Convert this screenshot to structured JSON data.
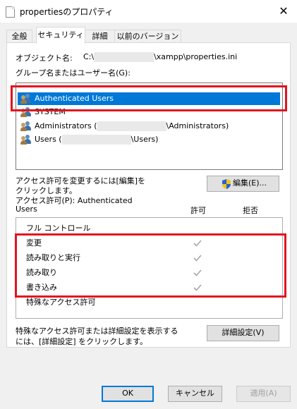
{
  "window": {
    "title": "propertiesのプロパティ",
    "close_glyph": "✕"
  },
  "tabs": [
    {
      "label": "全般",
      "active": false
    },
    {
      "label": "セキュリティ",
      "active": true
    },
    {
      "label": "詳細",
      "active": false
    },
    {
      "label": "以前のバージョン",
      "active": false
    }
  ],
  "security": {
    "object_name_label": "オブジェクト名:",
    "object_path_prefix": "C:\\",
    "object_path_suffix": "\\xampp\\properties.ini",
    "group_label": "グループ名またはユーザー名(G):",
    "users": [
      {
        "name": "Authenticated Users",
        "selected": true,
        "icon": "users-group-icon"
      },
      {
        "name": "SYSTEM",
        "selected": false,
        "icon": "users-group-icon"
      },
      {
        "name_prefix": "Administrators (",
        "name_suffix": "\\Administrators)",
        "selected": false,
        "icon": "users-group-icon"
      },
      {
        "name_prefix": "Users (",
        "name_suffix": "\\Users)",
        "selected": false,
        "icon": "users-group-icon"
      }
    ],
    "change_hint_line1": "アクセス許可を変更するには[編集]を",
    "change_hint_line2": "クリックします。",
    "edit_button_label": "編集(E)...",
    "permissions_for_label": "アクセス許可(P): Authenticated",
    "permissions_for_label2": "Users",
    "allow_header": "許可",
    "deny_header": "拒否",
    "permissions": [
      {
        "name": "フル コントロール",
        "allow": false,
        "deny": false
      },
      {
        "name": "変更",
        "allow": true,
        "deny": false
      },
      {
        "name": "読み取りと実行",
        "allow": true,
        "deny": false
      },
      {
        "name": "読み取り",
        "allow": true,
        "deny": false
      },
      {
        "name": "書き込み",
        "allow": true,
        "deny": false
      },
      {
        "name": "特殊なアクセス許可",
        "allow": false,
        "deny": false
      }
    ],
    "advanced_hint_line1": "特殊なアクセス許可または詳細設定を表示する",
    "advanced_hint_line2": "には、[詳細設定] をクリックします。",
    "advanced_button_label": "詳細設定(V)"
  },
  "footer": {
    "ok_label": "OK",
    "cancel_label": "キャンセル",
    "apply_label": "適用(A)"
  },
  "colors": {
    "selection": "#0078d7",
    "annotation_red": "#e3131f",
    "check_gray": "#a6a6a6"
  }
}
